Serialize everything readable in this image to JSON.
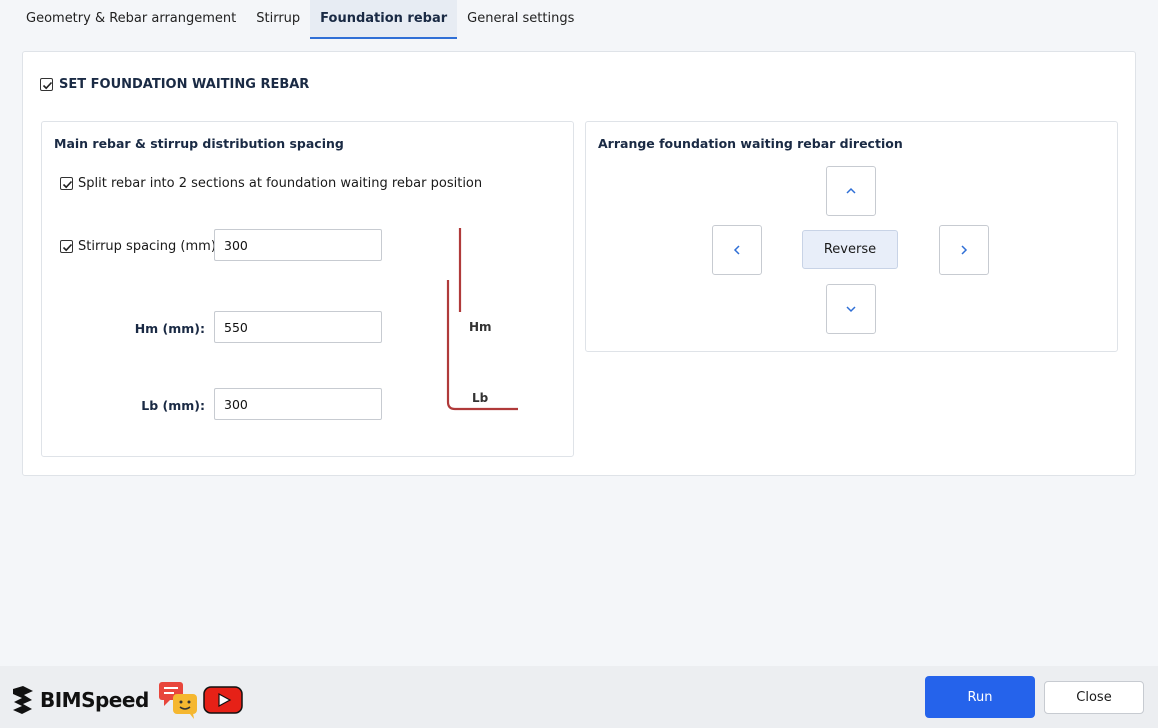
{
  "tabs": [
    {
      "label": "Geometry & Rebar arrangement",
      "active": false
    },
    {
      "label": "Stirrup",
      "active": false
    },
    {
      "label": "Foundation rebar",
      "active": true
    },
    {
      "label": "General settings",
      "active": false
    }
  ],
  "header": {
    "label": "SET FOUNDATION WAITING REBAR",
    "checked": true
  },
  "left_group": {
    "title": "Main rebar & stirrup distribution spacing",
    "split_label": "Split rebar into 2 sections at foundation waiting rebar position",
    "stirrup_label": "Stirrup spacing (mm):",
    "stirrup_value": "300",
    "hm_label": "Hm (mm):",
    "hm_value": "550",
    "lb_label": "Lb (mm):",
    "lb_value": "300",
    "diagram": {
      "hm": "Hm",
      "lb": "Lb",
      "color": "#b03a3a"
    }
  },
  "right_group": {
    "title": "Arrange foundation waiting rebar direction",
    "reverse_label": "Reverse"
  },
  "footer": {
    "brand": "BIMSpeed",
    "run_label": "Run",
    "close_label": "Close"
  },
  "colors": {
    "accent": "#2563eb",
    "tab_underline": "#2f6fd6",
    "youtube": "#e62117",
    "chat_red": "#e8463c",
    "chat_yellow": "#f5b730"
  }
}
